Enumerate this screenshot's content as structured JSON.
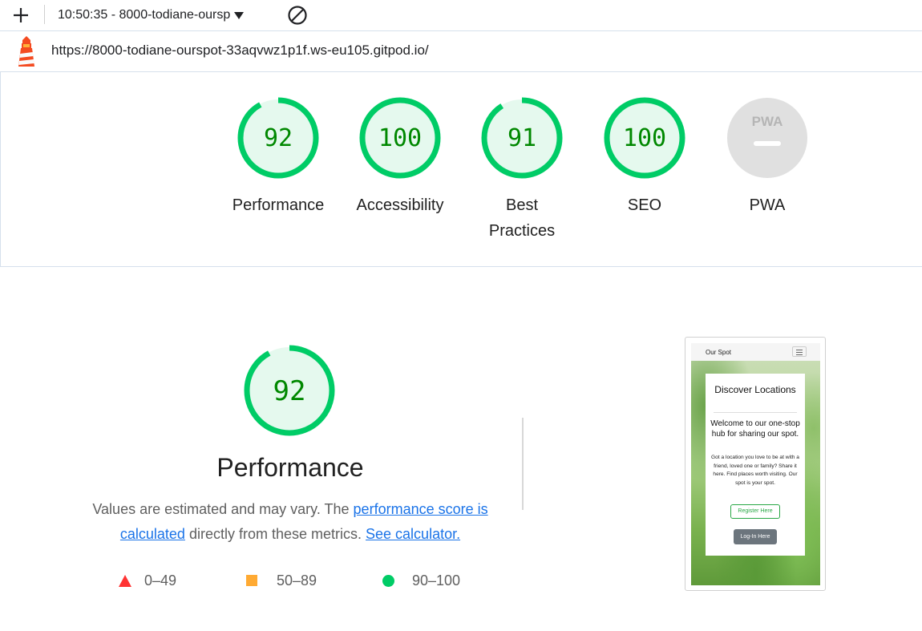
{
  "toolbar": {
    "report_label": "10:50:35 - 8000-todiane-oursp"
  },
  "url": "https://8000-todiane-ourspot-33aqvwz1p1f.ws-eu105.gitpod.io/",
  "gauges": [
    {
      "label": "Performance",
      "score": "92",
      "value": 92
    },
    {
      "label": "Accessibility",
      "score": "100",
      "value": 100
    },
    {
      "label": "Best Practices",
      "score": "91",
      "value": 91
    },
    {
      "label": "SEO",
      "score": "100",
      "value": 100
    },
    {
      "label": "PWA",
      "score": "",
      "badge": "PWA"
    }
  ],
  "performance": {
    "score": "92",
    "value": 92,
    "title": "Performance",
    "desc_pre": "Values are estimated and may vary. The ",
    "link_score": "performance score is calculated",
    "desc_mid": " directly from these metrics. ",
    "link_calc": "See calculator."
  },
  "legend": [
    {
      "range": "0–49",
      "color": "#ff3333"
    },
    {
      "range": "50–89",
      "color": "#ffaa33"
    },
    {
      "range": "90–100",
      "color": "#00cc66"
    }
  ],
  "thumbnail": {
    "brand": "Our Spot",
    "heading": "Discover Locations",
    "subheading": "Welcome to our one-stop hub for sharing our spot.",
    "body": "Got a location you love to be at with a friend, loved one or family? Share it here. Find places worth visiting. Our spot is your spot.",
    "register_label": "Register Here",
    "login_label": "Log-In Here"
  },
  "colors": {
    "pass": "#00cc66",
    "pass_text": "#008800",
    "pass_bg": "#e5f9ee",
    "link": "#1a73e8"
  }
}
